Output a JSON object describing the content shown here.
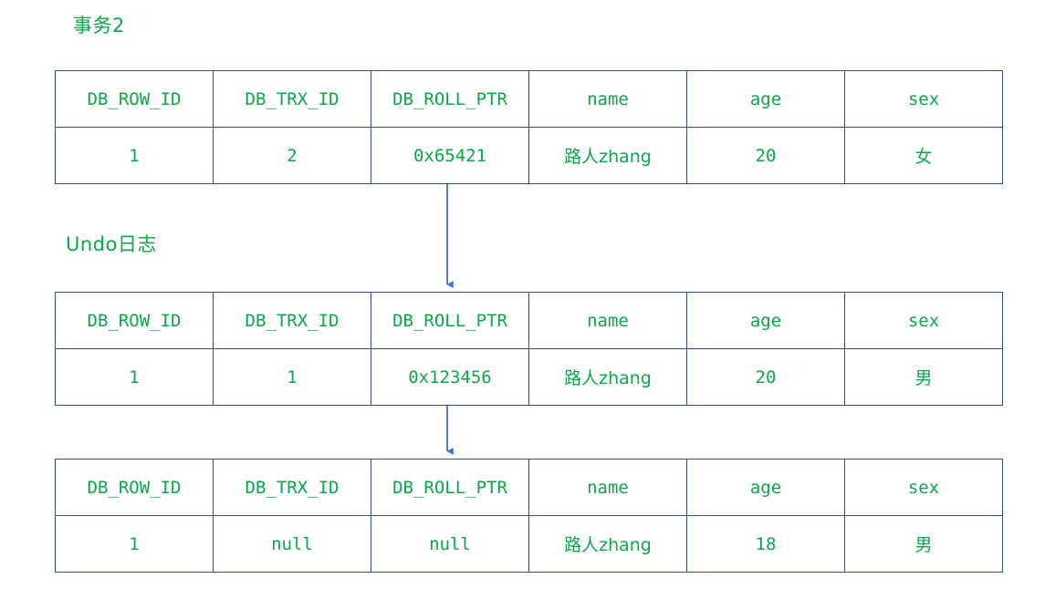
{
  "diagram": {
    "title_transaction": "事务2",
    "label_undo_log": "Undo日志",
    "accent_text_color": "#0BA84A",
    "border_color": "#32508E",
    "arrow_color": "#4472C4"
  },
  "columns": [
    "DB_ROW_ID",
    "DB_TRX_ID",
    "DB_ROLL_PTR",
    "name",
    "age",
    "sex"
  ],
  "tables": [
    {
      "name": "current-row-version",
      "headers": [
        "DB_ROW_ID",
        "DB_TRX_ID",
        "DB_ROLL_PTR",
        "name",
        "age",
        "sex"
      ],
      "row": [
        "1",
        "2",
        "0x65421",
        "路人zhang",
        "20",
        "女"
      ]
    },
    {
      "name": "undo-log-version-1",
      "headers": [
        "DB_ROW_ID",
        "DB_TRX_ID",
        "DB_ROLL_PTR",
        "name",
        "age",
        "sex"
      ],
      "row": [
        "1",
        "1",
        "0x123456",
        "路人zhang",
        "20",
        "男"
      ]
    },
    {
      "name": "undo-log-version-2",
      "headers": [
        "DB_ROW_ID",
        "DB_TRX_ID",
        "DB_ROLL_PTR",
        "name",
        "age",
        "sex"
      ],
      "row": [
        "1",
        "null",
        "null",
        "路人zhang",
        "18",
        "男"
      ]
    }
  ],
  "arrows": [
    {
      "name": "roll-ptr-arrow-1",
      "from": "current-row-version",
      "to": "undo-log-version-1"
    },
    {
      "name": "roll-ptr-arrow-2",
      "from": "undo-log-version-1",
      "to": "undo-log-version-2"
    }
  ]
}
